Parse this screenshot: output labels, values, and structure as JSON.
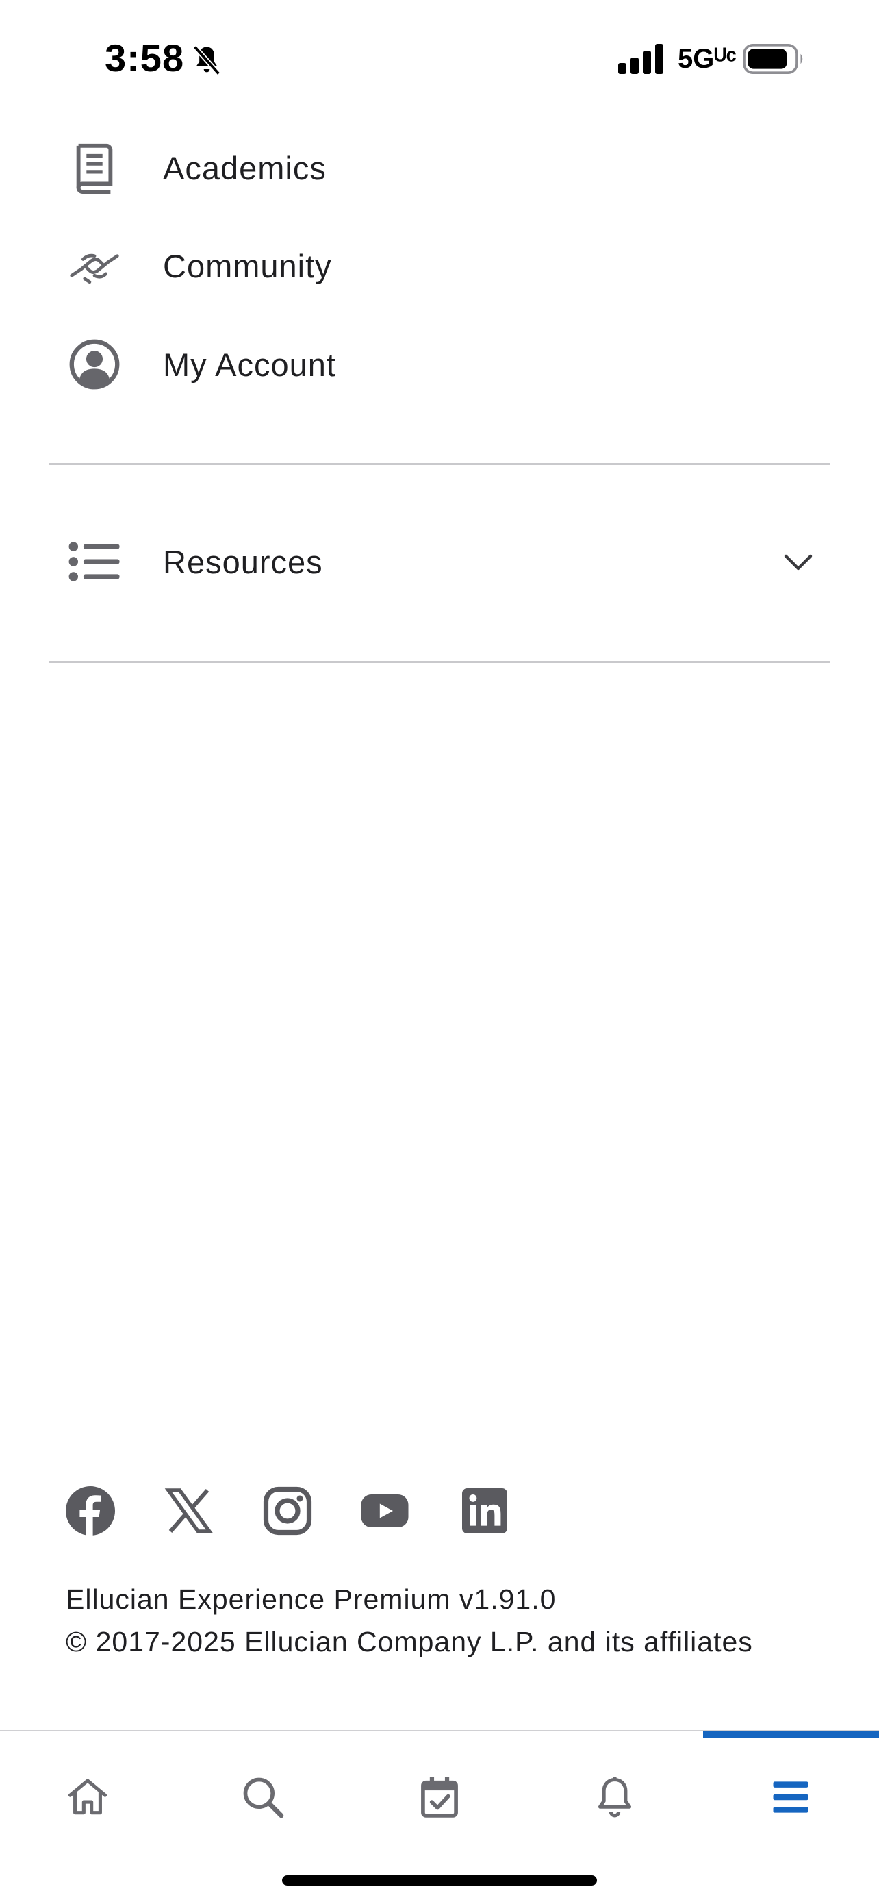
{
  "status_bar": {
    "time": "3:58",
    "network": "5Gᵁᶜ",
    "icons": [
      "bell-off-icon",
      "signal-icon",
      "battery-icon"
    ]
  },
  "menu": {
    "items": [
      {
        "label": "Academics",
        "icon": "book-icon"
      },
      {
        "label": "Community",
        "icon": "handshake-icon"
      },
      {
        "label": "My Account",
        "icon": "account-circle-icon"
      }
    ],
    "resources": {
      "label": "Resources",
      "icon": "list-icon",
      "expand_icon": "chevron-down-icon"
    }
  },
  "social_links": [
    "facebook-icon",
    "x-icon",
    "instagram-icon",
    "youtube-icon",
    "linkedin-icon"
  ],
  "footer": {
    "version": "Ellucian Experience Premium v1.91.0",
    "copyright": "© 2017-2025 Ellucian Company L.P. and its affiliates"
  },
  "tab_bar": {
    "tabs": [
      "home-icon",
      "search-icon",
      "calendar-check-icon",
      "notifications-icon",
      "menu-icon"
    ],
    "active": "menu",
    "accent_color": "#1565c0",
    "icon_color": "#6b6b70"
  }
}
